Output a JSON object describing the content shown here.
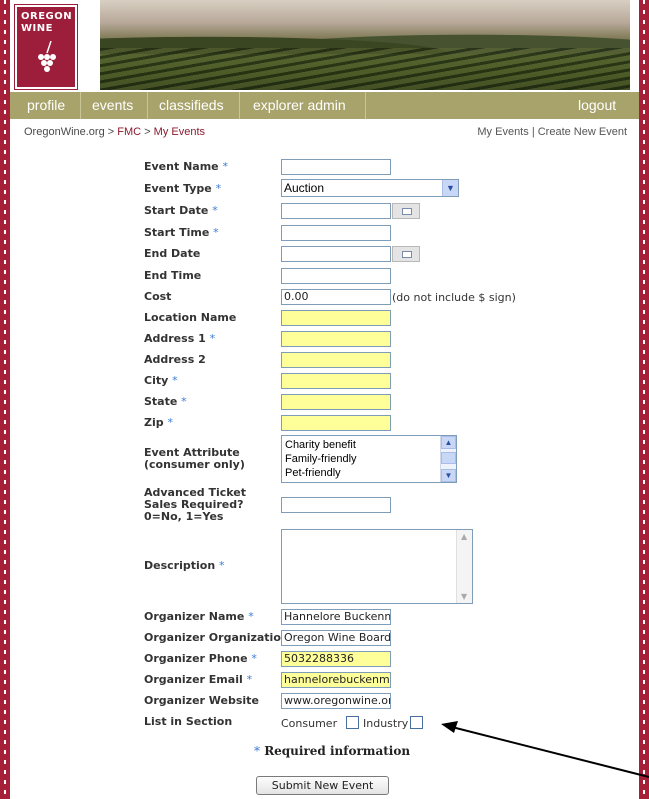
{
  "header": {
    "logo_line1": "OREGON",
    "logo_line2": "WINE"
  },
  "nav": {
    "items": [
      "profile",
      "events",
      "classifieds",
      "explorer admin"
    ],
    "logout": "logout"
  },
  "breadcrumb": {
    "root": "OregonWine.org",
    "sep": ">",
    "mid": "FMC",
    "current": "My Events"
  },
  "toplinks": {
    "my_events": "My Events",
    "sep": "|",
    "create": "Create New Event"
  },
  "form": {
    "event_name": {
      "label": "Event Name",
      "value": ""
    },
    "event_type": {
      "label": "Event Type",
      "value": "Auction"
    },
    "start_date": {
      "label": "Start Date",
      "value": ""
    },
    "start_time": {
      "label": "Start Time",
      "value": ""
    },
    "end_date": {
      "label": "End Date",
      "value": ""
    },
    "end_time": {
      "label": "End Time",
      "value": ""
    },
    "cost": {
      "label": "Cost",
      "value": "0.00",
      "note": "(do not include $ sign)"
    },
    "location_name": {
      "label": "Location Name",
      "value": ""
    },
    "address1": {
      "label": "Address 1",
      "value": ""
    },
    "address2": {
      "label": "Address 2",
      "value": ""
    },
    "city": {
      "label": "City",
      "value": ""
    },
    "state": {
      "label": "State",
      "value": ""
    },
    "zip": {
      "label": "Zip",
      "value": ""
    },
    "event_attribute": {
      "label_line1": "Event Attribute",
      "label_line2": "(consumer only)",
      "options": [
        "Charity benefit",
        "Family-friendly",
        "Pet-friendly"
      ]
    },
    "advanced_ticket": {
      "label_line1": "Advanced Ticket",
      "label_line2": "Sales Required?",
      "label_line3": "0=No, 1=Yes",
      "value": ""
    },
    "description": {
      "label": "Description",
      "value": ""
    },
    "organizer_name": {
      "label": "Organizer Name",
      "value": "Hannelore Buckenmey"
    },
    "organizer_org": {
      "label": "Organizer Organization",
      "value": "Oregon Wine Board"
    },
    "organizer_phone": {
      "label": "Organizer Phone",
      "value": "5032288336"
    },
    "organizer_email": {
      "label": "Organizer Email",
      "value": "hannelorebuckenmey"
    },
    "organizer_website": {
      "label": "Organizer Website",
      "value": "www.oregonwine.org"
    },
    "list_in_section": {
      "label": "List in Section",
      "consumer": "Consumer",
      "industry": "Industry"
    },
    "required_star": "*",
    "required_info": "Required information",
    "submit": "Submit New Event"
  },
  "colors": {
    "brand_red": "#a7203a",
    "nav_olive": "#a8a36b",
    "required_blue": "#3a7bd5",
    "highlight_yellow": "#ffff99"
  }
}
